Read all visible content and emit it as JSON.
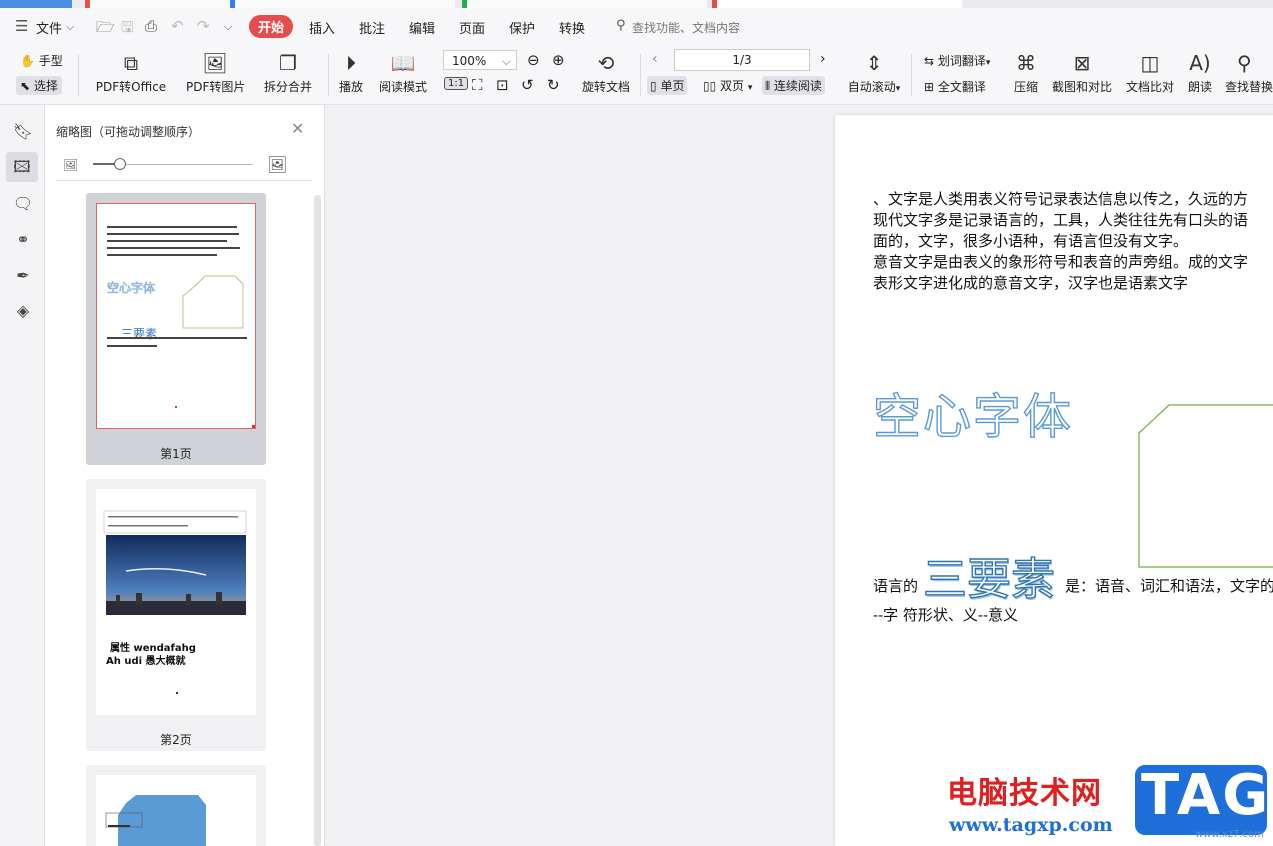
{
  "menubar": {
    "file_label": "文件",
    "tabs": [
      "开始",
      "插入",
      "批注",
      "编辑",
      "页面",
      "保护",
      "转换"
    ],
    "search_placeholder": "查找功能、文档内容"
  },
  "toolbar": {
    "hand_label": "手型",
    "select_label": "选择",
    "pdf_to_office": "PDF转Office",
    "pdf_to_image": "PDF转图片",
    "split_merge": "拆分合并",
    "play": "播放",
    "read_mode": "阅读模式",
    "zoom_value": "100%",
    "rotate_doc": "旋转文档",
    "page_value": "1/3",
    "single_page": "单页",
    "double_page": "双页",
    "continuous": "连续阅读",
    "auto_scroll": "自动滚动",
    "word_translate": "划词翻译",
    "full_translate": "全文翻译",
    "compress": "压缩",
    "screenshot_compare": "截图和对比",
    "doc_compare": "文档比对",
    "read_aloud": "朗读",
    "find_replace": "查找替换",
    "actual_size": "1:1"
  },
  "thumbnails": {
    "title": "缩略图（可拖动调整顺序）",
    "pages": [
      {
        "label": "第1页"
      },
      {
        "label": "第2页"
      }
    ],
    "page2": {
      "line1": "属性 wendafahg",
      "line2": "Ah udi 愚大概就"
    }
  },
  "document": {
    "lines": [
      "、文字是人类用表义符号记录表达信息以传之，久远的方",
      "现代文字多是记录语言的，工具，人类往往先有口头的语",
      "面的，文字，很多小语种，有语言但没有文字。",
      "意音文字是由表义的象形符号和表音的声旁组。成的文字",
      "表形文字进化成的意音文字，汉字也是语素文字"
    ],
    "hollow_text": "空心字体",
    "line_a_prefix": "语言的",
    "big_text": "三要素",
    "line_a_suffix": "是：语音、词汇和语法，文字的",
    "line_b": "--字  符形状、义--意义"
  },
  "watermark": {
    "cn": "电脑技术网",
    "url": "www.tagxp.com",
    "logo": "TAG",
    "small": "www.xz7.com"
  },
  "colors": {
    "accent": "#e64c4c",
    "hollow": "#5b9bd5",
    "watermark_red": "#e02020",
    "watermark_blue": "#1e6fd9"
  }
}
